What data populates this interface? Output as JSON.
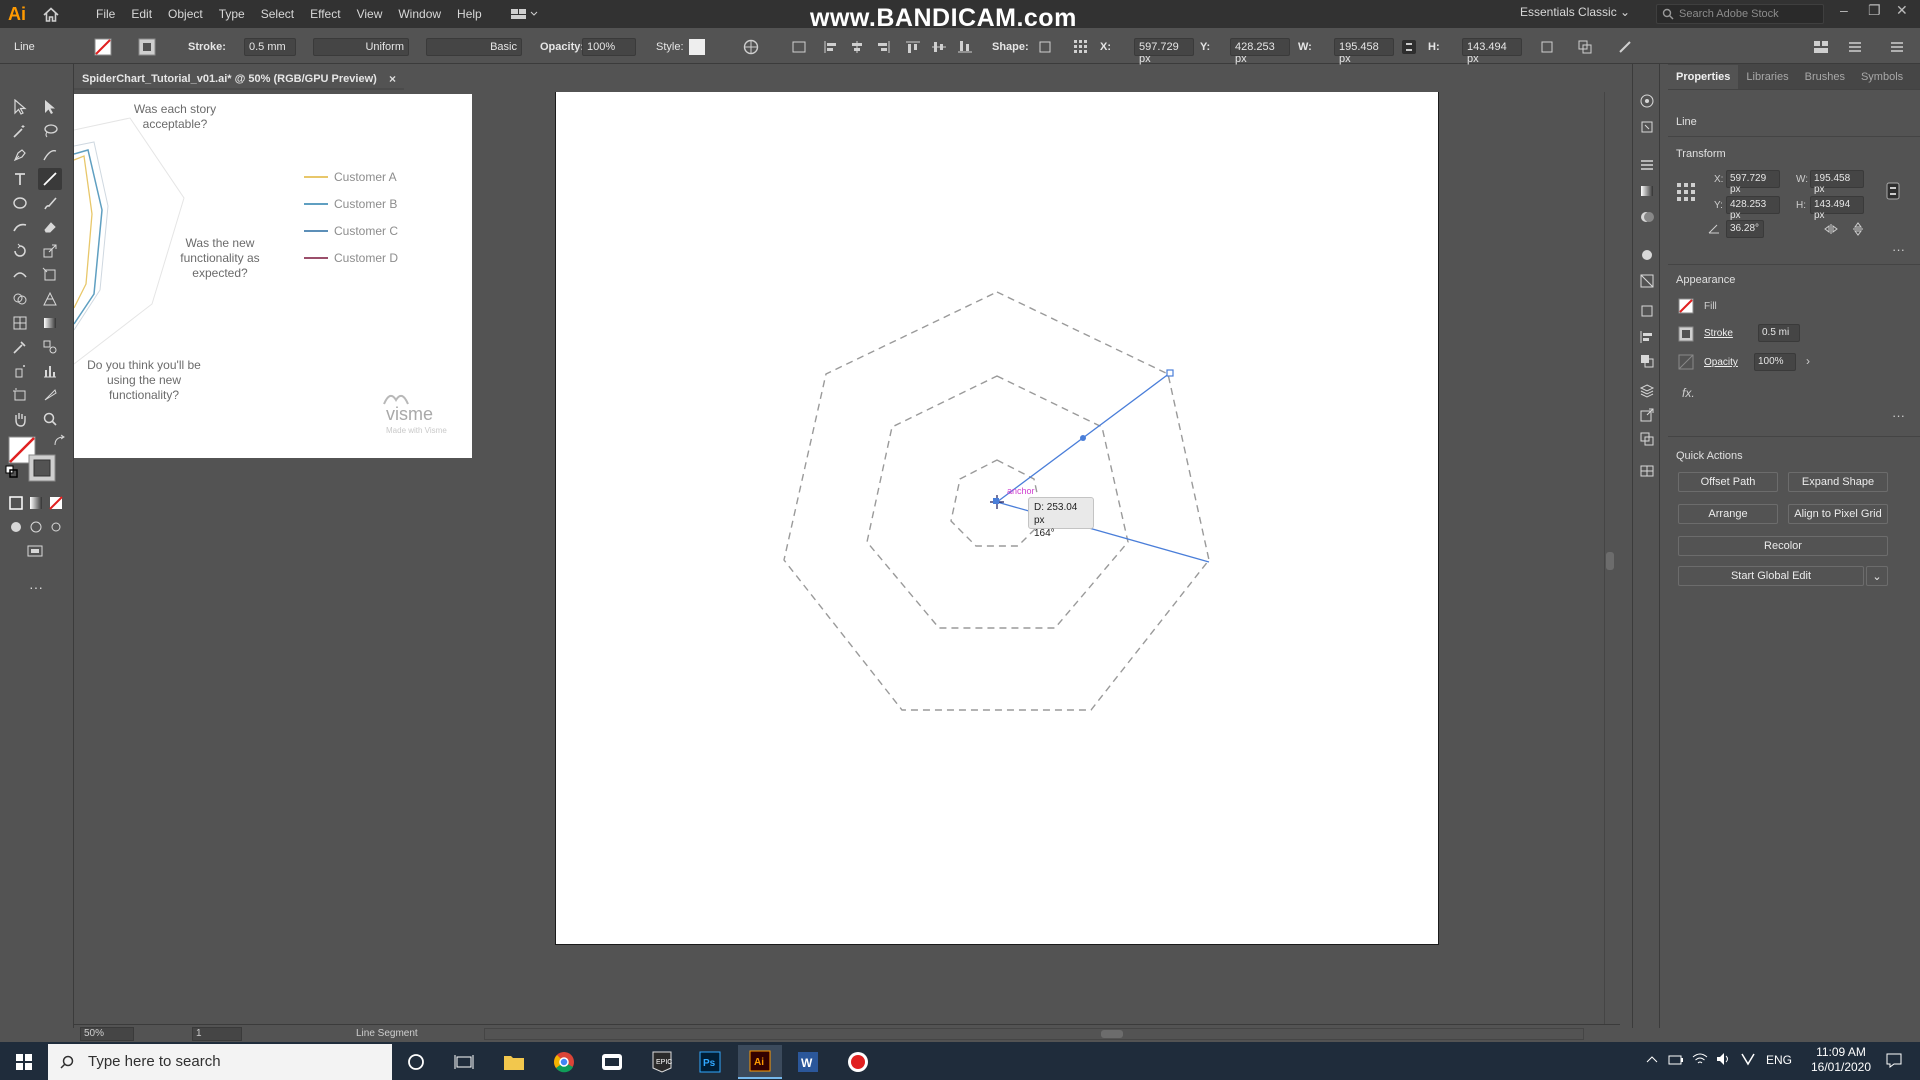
{
  "app": {
    "logo": "Ai",
    "menu": [
      "File",
      "Edit",
      "Object",
      "Type",
      "Select",
      "Effect",
      "View",
      "Window",
      "Help"
    ],
    "watermark": "www.BANDICAM.com",
    "workspace": "Essentials Classic",
    "stock_search_placeholder": "Search Adobe Stock"
  },
  "control_bar": {
    "selection_type": "Line",
    "stroke_label": "Stroke:",
    "stroke_value": "0.5 mm",
    "profile_uniform": "Uniform",
    "brush_basic": "Basic",
    "opacity_label": "Opacity:",
    "opacity_value": "100%",
    "style_label": "Style:",
    "shape_label": "Shape:",
    "x_label": "X:",
    "x_value": "597.729 px",
    "y_label": "Y:",
    "y_value": "428.253 px",
    "w_label": "W:",
    "w_value": "195.458 px",
    "h_label": "H:",
    "h_value": "143.494 px"
  },
  "document": {
    "tab_title": "SpiderChart_Tutorial_v01.ai* @ 50% (RGB/GPU Preview)",
    "close": "×"
  },
  "left_artboard": {
    "question1": "Was each story acceptable?",
    "question2": "Was the new functionality as expected?",
    "question3": "Do you think you'll be using the new functionality?",
    "legend": [
      {
        "label": "Customer A",
        "color": "#e8c76a"
      },
      {
        "label": "Customer B",
        "color": "#5f9fc1"
      },
      {
        "label": "Customer C",
        "color": "#5c8fb8"
      },
      {
        "label": "Customer D",
        "color": "#9b4f6b"
      }
    ],
    "brand": "visme",
    "brand_sub": "Made with Visme"
  },
  "canvas": {
    "anchor_hint": "anchor",
    "measure_distance": "D: 253.04 px",
    "measure_angle": "164°",
    "line_color": "#4a7ed9",
    "hint_color": "#d040d0"
  },
  "properties_panel": {
    "tabs": [
      "Properties",
      "Libraries",
      "Brushes",
      "Symbols"
    ],
    "object_type": "Line",
    "transform_title": "Transform",
    "x_label": "X:",
    "x_value": "597.729 px",
    "y_label": "Y:",
    "y_value": "428.253 px",
    "w_label": "W:",
    "w_value": "195.458 px",
    "h_label": "H:",
    "h_value": "143.494 px",
    "angle_value": "36.28°",
    "appearance_title": "Appearance",
    "fill_label": "Fill",
    "stroke_label": "Stroke",
    "stroke_value": "0.5 mi",
    "opacity_label": "Opacity",
    "opacity_value": "100%",
    "fx": "fx.",
    "quick_actions_title": "Quick Actions",
    "actions": [
      "Offset Path",
      "Expand Shape",
      "Arrange",
      "Align to Pixel Grid",
      "Recolor",
      "Start Global Edit"
    ]
  },
  "status_bar": {
    "zoom": "50%",
    "artboard_number": "1",
    "tool_name": "Line Segment"
  },
  "taskbar": {
    "search_placeholder": "Type here to search",
    "language": "ENG",
    "time": "11:09 AM",
    "date": "16/01/2020"
  }
}
